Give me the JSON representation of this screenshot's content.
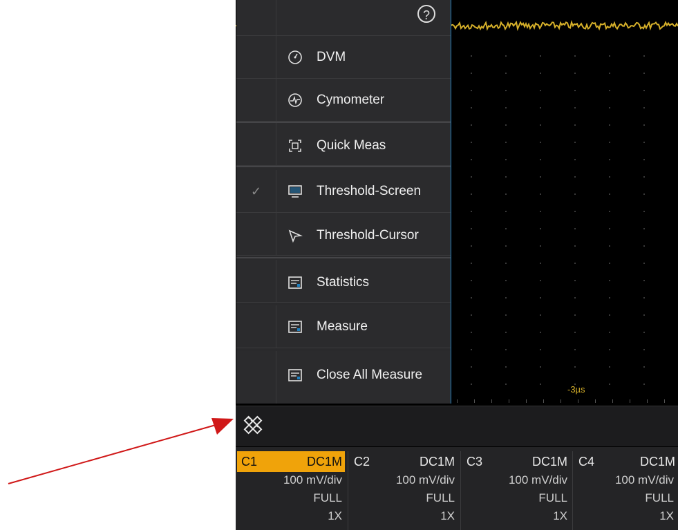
{
  "menu": {
    "help_icon": "?",
    "items": [
      {
        "label": "DVM",
        "icon": "dvm-icon",
        "checked": false
      },
      {
        "label": "Cymometer",
        "icon": "cymometer-icon",
        "checked": false
      },
      {
        "label": "Quick Meas",
        "icon": "quick-meas-icon",
        "checked": false
      },
      {
        "label": "Threshold-Screen",
        "icon": "monitor-icon",
        "checked": true
      },
      {
        "label": "Threshold-Cursor",
        "icon": "cursor-arrow-icon",
        "checked": false
      },
      {
        "label": "Statistics",
        "icon": "statistics-icon",
        "checked": false
      },
      {
        "label": "Measure",
        "icon": "measure-icon",
        "checked": false
      },
      {
        "label": "Close All Measure",
        "icon": "close-measure-icon",
        "checked": false
      }
    ],
    "check_mark": "✓"
  },
  "waveform": {
    "channel_marker": "C1",
    "time_labels": [
      "-3µs"
    ],
    "trace_color": "#d6b02a"
  },
  "toolbar": {
    "tool_icon": "measure-tools-icon"
  },
  "channels": [
    {
      "name": "C1",
      "coupling": "DC1M",
      "scale": "100 mV/div",
      "bandwidth": "FULL",
      "probe": "1X",
      "active": true
    },
    {
      "name": "C2",
      "coupling": "DC1M",
      "scale": "100 mV/div",
      "bandwidth": "FULL",
      "probe": "1X",
      "active": false
    },
    {
      "name": "C3",
      "coupling": "DC1M",
      "scale": "100 mV/div",
      "bandwidth": "FULL",
      "probe": "1X",
      "active": false
    },
    {
      "name": "C4",
      "coupling": "DC1M",
      "scale": "100 mV/div",
      "bandwidth": "FULL",
      "probe": "1X",
      "active": false
    }
  ],
  "colors": {
    "accent": "#f0a30a",
    "menu_border": "#1e7fbf",
    "annotation_arrow": "#d01818"
  }
}
